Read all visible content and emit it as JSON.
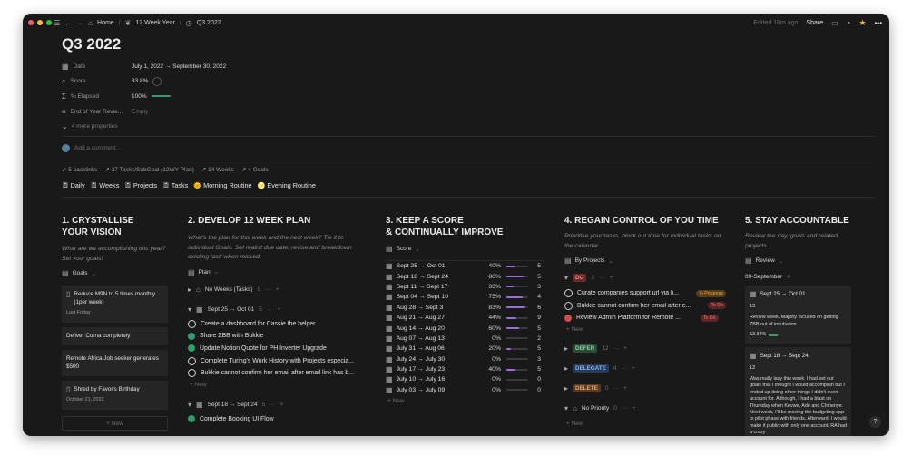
{
  "topbar": {
    "crumbs": [
      "Home",
      "12 Week Year",
      "Q3 2022"
    ],
    "edited": "Edited 18m ago",
    "share": "Share"
  },
  "page": {
    "title": "Q3 2022",
    "props": [
      {
        "name": "Date",
        "value": "July 1, 2022 → September 30, 2022"
      },
      {
        "name": "Score",
        "value": "33.8%"
      },
      {
        "name": "% Elapsed",
        "value": "100%"
      },
      {
        "name": "End of Year Revie...",
        "value": "Empty"
      }
    ],
    "more": "4 more properties",
    "comment_placeholder": "Add a comment...",
    "links": [
      "5 backlinks",
      "37 Tasks/SubGoal (12WY Plan)",
      "14 Weeks",
      "4 Goals"
    ],
    "nav": [
      "Daily",
      "Weeks",
      "Projects",
      "Tasks",
      "Morning Routine",
      "Evening Routine"
    ]
  },
  "col1": {
    "heading": [
      "1. CRYSTALLISE",
      "YOUR VISION"
    ],
    "desc": "What are we accomplishing this year? Set your goals!",
    "view": "Goals",
    "cards": [
      {
        "title": "Reduce M9N to 5 times monthly (1per week)",
        "sub": "Last Friday"
      },
      {
        "title": "Deliver Corna completely",
        "sub": ""
      },
      {
        "title": "Remote Africa Job seeker generates $500",
        "sub": ""
      },
      {
        "title": "Shred by Favor's Birthday",
        "sub": "October 21, 2022"
      }
    ],
    "new": "+ New"
  },
  "col2": {
    "heading": [
      "2. DEVELOP 12 WEEK PLAN"
    ],
    "desc": "What's the plan for this week and the next week? Tie it to individual Goals. Set realist due date, revise and breakdown existing task when missed.",
    "view": "Plan",
    "group1": {
      "label": "No Weeks (Tasks)",
      "count": "5"
    },
    "group2": {
      "label": "Sept 25 → Oct 01",
      "count": "5"
    },
    "tasks": [
      {
        "text": "Create a dashboard for Cassie the helper",
        "done": false
      },
      {
        "text": "Share ZBB with Bukkie",
        "done": true
      },
      {
        "text": "Update Notion Quote for PH Inverter Upgrade",
        "done": true
      },
      {
        "text": "Complete Turing's Work History with Projects especia...",
        "done": false
      },
      {
        "text": "Bukkie cannot confirm her email after email link has b...",
        "done": false
      }
    ],
    "new": "+ New",
    "group3": {
      "label": "Sept 18 → Sept 24",
      "count": "5"
    },
    "task_last": "Complete Booking UI Flow"
  },
  "col3": {
    "heading": [
      "3. KEEP A SCORE",
      "& CONTINUALLY IMPROVE"
    ],
    "view": "Score",
    "rows": [
      {
        "name": "Sept 25 → Oct 01",
        "pct": "40%",
        "fill": 0.4,
        "n": "5"
      },
      {
        "name": "Sept 18 → Sept 24",
        "pct": "80%",
        "fill": 0.8,
        "n": "5"
      },
      {
        "name": "Sept 11 → Sept 17",
        "pct": "33%",
        "fill": 0.33,
        "n": "3"
      },
      {
        "name": "Sept 04 → Sept 10",
        "pct": "75%",
        "fill": 0.75,
        "n": "4"
      },
      {
        "name": "Aug 28 → Sept 3",
        "pct": "83%",
        "fill": 0.83,
        "n": "6"
      },
      {
        "name": "Aug 21 → Aug 27",
        "pct": "44%",
        "fill": 0.44,
        "n": "9"
      },
      {
        "name": "Aug 14 → Aug 20",
        "pct": "60%",
        "fill": 0.6,
        "n": "5"
      },
      {
        "name": "Aug 07 → Aug 13",
        "pct": "0%",
        "fill": 0,
        "n": "2"
      },
      {
        "name": "July 31 → Aug 06",
        "pct": "20%",
        "fill": 0.2,
        "n": "5"
      },
      {
        "name": "July 24 → July 30",
        "pct": "0%",
        "fill": 0,
        "n": "3"
      },
      {
        "name": "July 17 → July 23",
        "pct": "40%",
        "fill": 0.4,
        "n": "5"
      },
      {
        "name": "July 10 → July 16",
        "pct": "0%",
        "fill": 0,
        "n": "0"
      },
      {
        "name": "July 03 → July 09",
        "pct": "0%",
        "fill": 0,
        "n": "0"
      }
    ],
    "new": "+ New"
  },
  "col4": {
    "heading": [
      "4. REGAIN CONTROL OF YOU TIME"
    ],
    "desc": "Prioritise your tasks, block out time for individual tasks on the calendar",
    "view": "By Projects",
    "do": {
      "label": "DO",
      "count": "3"
    },
    "tasks": [
      {
        "text": "Curate companies support url via li...",
        "badge": "In Progress",
        "red": false
      },
      {
        "text": "Bukkie cannot confirm her email after e...",
        "badge": "To Do",
        "red": false
      },
      {
        "text": "Review Admin Platform for Remote ...",
        "badge": "To Do",
        "red": true
      }
    ],
    "new": "+ New",
    "groups": [
      {
        "label": "DEFER",
        "count": "12",
        "bg": "#2b4a3a",
        "fg": "#7fd1a3"
      },
      {
        "label": "DELEGATE",
        "count": "4",
        "bg": "#253a5c",
        "fg": "#88b3ee"
      },
      {
        "label": "DELETE",
        "count": "0",
        "bg": "#5a3a1e",
        "fg": "#e7a66a"
      }
    ],
    "nopri": {
      "label": "No Priority",
      "count": "0"
    },
    "new2": "+ New"
  },
  "col5": {
    "heading": [
      "5. STAY ACCOUNTABLE"
    ],
    "desc": "Review the day, goals and related projects",
    "view": "Review",
    "date": "09-September",
    "date_count": "4",
    "card1": {
      "title": "Sept 25 → Oct 01",
      "n": "13",
      "text": "Review week, Majorly focused on getting ZBB out of incubation.",
      "pct": "53.34%"
    },
    "card2": {
      "title": "Sept 18 → Sept 24",
      "n": "12",
      "text": "Was really lazy this week. I had set out goals that I thought I would accomplish but I ended up doing other things I didn't even account for.  Although, I had a blast on Thursday when Kevwe, Ade and Chinenye. Next week, I'll be moving the budgeting app to pilot phase with friends. Afterward, I would make it public with only one account, RA had a crazy"
    }
  },
  "colors": {
    "bg": "#191919",
    "green": "#2f9e6e",
    "purple": "#9a6dd7",
    "red": "#d44c47"
  }
}
